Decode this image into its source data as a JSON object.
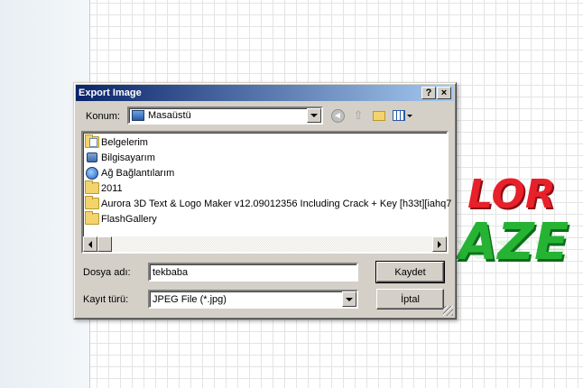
{
  "background_logo": {
    "line1": "LOR",
    "line2": "AZE"
  },
  "dialog": {
    "title": "Export Image",
    "help_label": "?",
    "close_label": "×",
    "location": {
      "label": "Konum:",
      "value": "Masaüstü"
    },
    "toolbar": {
      "back_icon": "back-arrow-icon",
      "up_icon": "up-folder-icon",
      "new_folder_icon": "new-folder-icon",
      "view_icon": "view-menu-icon"
    },
    "files": [
      {
        "name": "Belgelerim",
        "icon": "my-documents-icon"
      },
      {
        "name": "Bilgisayarım",
        "icon": "computer-icon"
      },
      {
        "name": "Ağ Bağlantılarım",
        "icon": "network-icon"
      },
      {
        "name": "2011",
        "icon": "folder-icon"
      },
      {
        "name": "Aurora 3D Text & Logo Maker v12.09012356 Including Crack + Key [h33t][iahq7",
        "icon": "folder-icon"
      },
      {
        "name": "FlashGallery",
        "icon": "folder-icon"
      }
    ],
    "filename": {
      "label": "Dosya adı:",
      "value": "tekbaba"
    },
    "filetype": {
      "label": "Kayıt türü:",
      "value": "JPEG File (*.jpg)"
    },
    "save_label": "Kaydet",
    "cancel_label": "İptal"
  }
}
